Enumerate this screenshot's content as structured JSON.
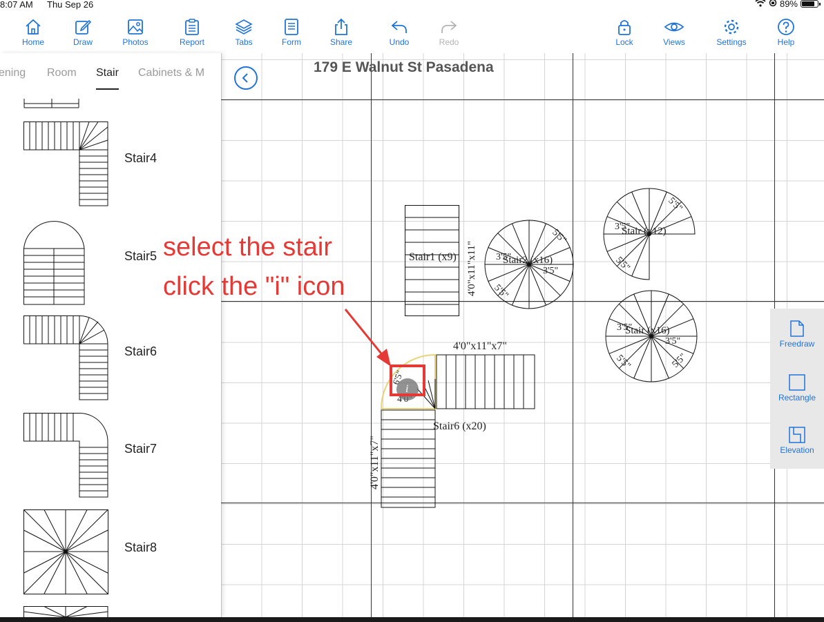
{
  "status": {
    "time": "8:07 AM",
    "date": "Thu Sep 26",
    "battery": "89%",
    "battery_level": 0.89
  },
  "toolbar": {
    "home": "Home",
    "draw": "Draw",
    "photos": "Photos",
    "report": "Report",
    "tabs": "Tabs",
    "form": "Form",
    "share": "Share",
    "undo": "Undo",
    "redo": "Redo",
    "lock": "Lock",
    "views": "Views",
    "settings": "Settings",
    "help": "Help"
  },
  "sidebar": {
    "tabs": [
      "ening",
      "Room",
      "Stair",
      "Cabinets & M"
    ],
    "active_tab": "Stair",
    "items": [
      "Stair4",
      "Stair5",
      "Stair6",
      "Stair7",
      "Stair8"
    ]
  },
  "canvas": {
    "title": "179 E Walnut St Pasadena",
    "stair1": {
      "label": "Stair1 (x9)",
      "dims": "4'0\"x11\"x11\""
    },
    "stair2": {
      "label": "Stair2 (x16)",
      "dim": "3'5\"",
      "dim_short": "5'5\""
    },
    "stair_top_right": {
      "label": "Stair (x12)",
      "dim": "3'5\"",
      "dim_short": "5'5\""
    },
    "stair_bottom_right": {
      "label": "Stair (x16)",
      "dim": "3'5\"",
      "dim_short": "5'5\""
    },
    "stair6": {
      "label": "Stair6 (x20)",
      "dims_top": "4'0\"x11\"x7\"",
      "dims_left": "4'0\"x11\"x7\"",
      "corner": "4'0\"",
      "corner_small": "6'5\""
    }
  },
  "side_tools": {
    "freedraw": "Freedraw",
    "rectangle": "Rectangle",
    "elevation": "Elevation"
  },
  "annotation": {
    "line1": "select the stair",
    "line2": "click the \"i\" icon"
  },
  "colors": {
    "accent": "#1f73d6",
    "annotation": "#e53935",
    "selection": "#e8d37a"
  }
}
